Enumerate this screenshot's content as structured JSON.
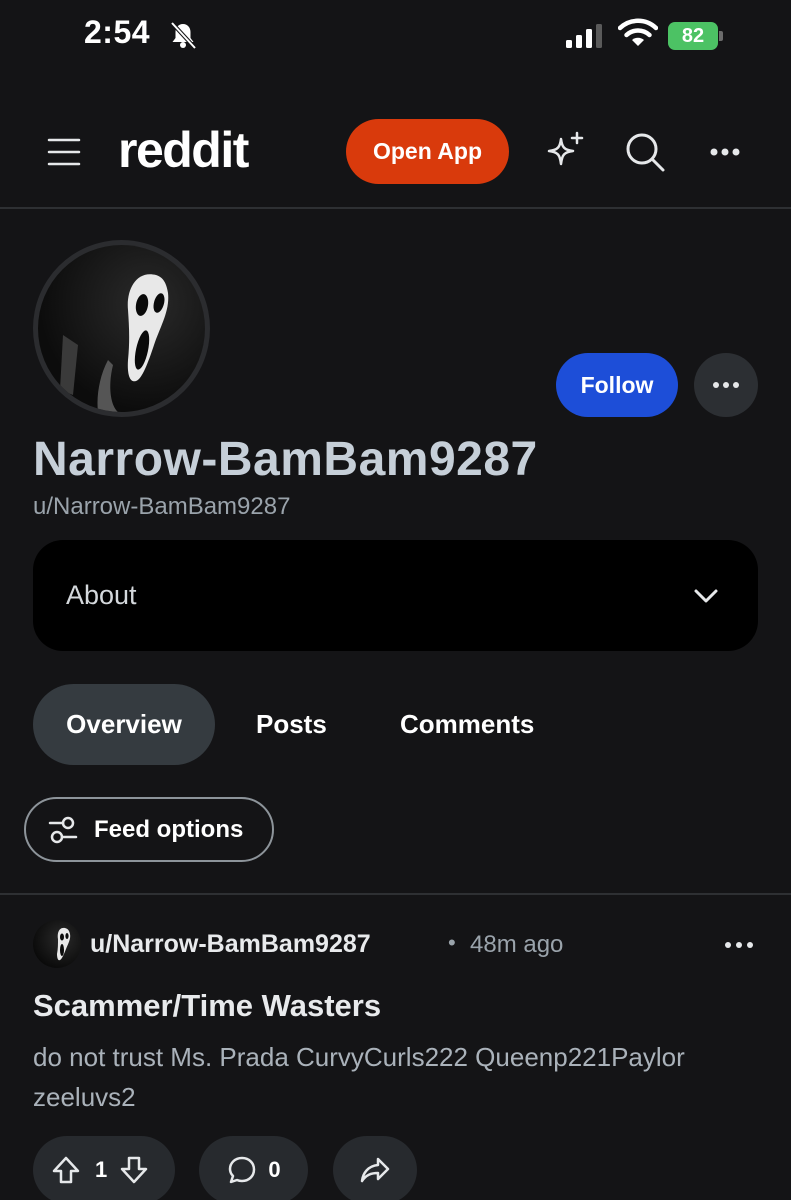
{
  "status_bar": {
    "time": "2:54",
    "battery": "82",
    "icons": [
      "bell-off-icon",
      "signal-icon",
      "wifi-icon",
      "battery-charging-icon"
    ]
  },
  "header": {
    "logo": "reddit",
    "open_app_label": "Open App",
    "icons": [
      "menu-icon",
      "sparkle-icon",
      "search-icon",
      "more-icon"
    ]
  },
  "profile": {
    "display_name": "Narrow-BamBam9287",
    "username": "u/Narrow-BamBam9287",
    "follow_label": "Follow",
    "avatar_icon": "ghostface-mask-icon"
  },
  "about": {
    "label": "About"
  },
  "tabs": [
    {
      "label": "Overview",
      "active": true
    },
    {
      "label": "Posts",
      "active": false
    },
    {
      "label": "Comments",
      "active": false
    }
  ],
  "feed_options": {
    "label": "Feed options"
  },
  "post": {
    "author": "u/Narrow-BamBam9287",
    "separator": "•",
    "time": "48m ago",
    "title": "Scammer/Time Wasters",
    "body": "do not trust Ms. Prada CurvyCurls222 Queenp221Paylor zeeluvs2",
    "upvotes": "1",
    "comments": "0"
  },
  "colors": {
    "background": "#141416",
    "open_app": "#d93a0c",
    "follow": "#1d4ed8",
    "battery": "#4cc264",
    "active_tab": "#353b40"
  }
}
